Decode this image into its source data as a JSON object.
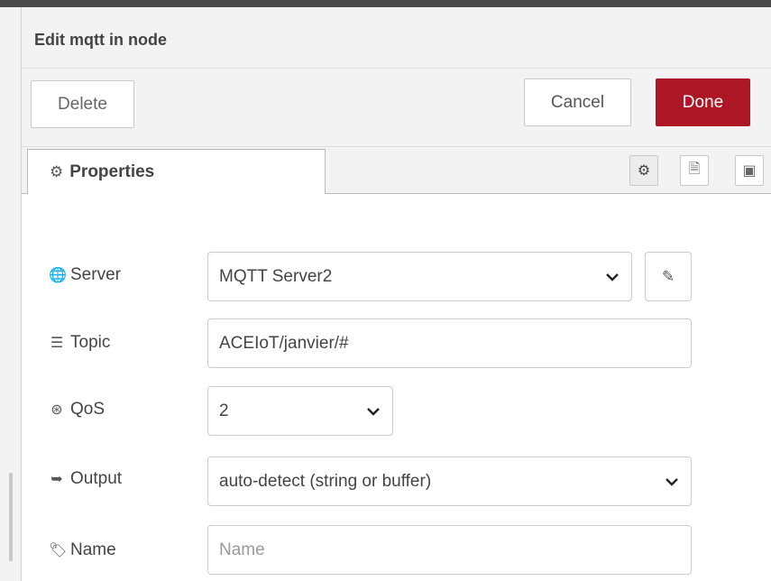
{
  "tray": {
    "title": "Edit mqtt in node"
  },
  "toolbar": {
    "delete_label": "Delete",
    "cancel_label": "Cancel",
    "done_label": "Done",
    "done_color": "#ad1625"
  },
  "tabs": {
    "properties_icon": "⚙",
    "properties_label": "Properties",
    "icons": [
      {
        "name": "gear-icon",
        "glyph": "⚙",
        "active": true
      },
      {
        "name": "description-icon",
        "glyph": "🗎",
        "active": false
      },
      {
        "name": "appearance-icon",
        "glyph": "▣",
        "active": false
      }
    ]
  },
  "form": {
    "server": {
      "icon": "globe-icon",
      "glyph": "🌐",
      "label": "Server",
      "value": "MQTT Server2",
      "edit_glyph": "✎"
    },
    "topic": {
      "icon": "tasks-icon",
      "glyph": "☰",
      "label": "Topic",
      "value": "ACEIoT/janvier/#"
    },
    "qos": {
      "icon": "empire-icon",
      "glyph": "⊛",
      "label": "QoS",
      "value": "2"
    },
    "output": {
      "icon": "sign-out-icon",
      "glyph": "➥",
      "label": "Output",
      "value": "auto-detect (string or buffer)"
    },
    "name": {
      "icon": "tag-icon",
      "glyph": "🏷",
      "label": "Name",
      "placeholder": "Name",
      "value": ""
    }
  }
}
